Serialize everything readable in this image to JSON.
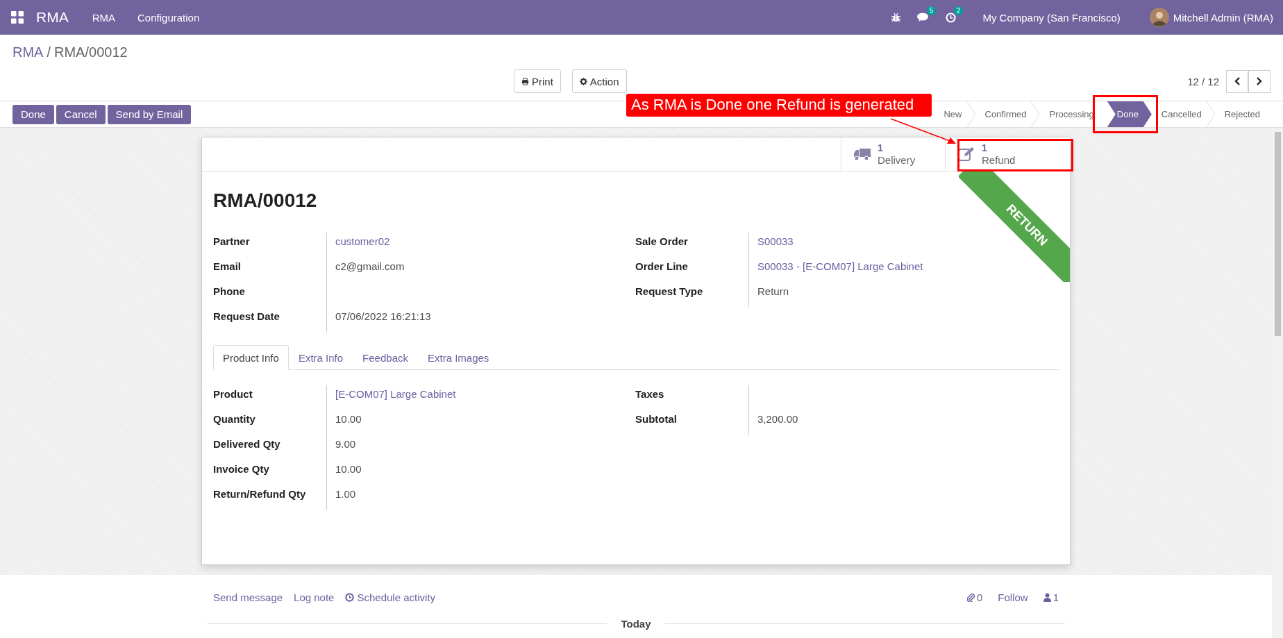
{
  "navbar": {
    "app_name": "RMA",
    "menus": [
      "RMA",
      "Configuration"
    ],
    "messages_count": "5",
    "activities_count": "2",
    "company": "My Company (San Francisco)",
    "user": "Mitchell Admin (RMA)"
  },
  "breadcrumb": {
    "parent": "RMA",
    "separator": "/",
    "current": "RMA/00012"
  },
  "actions": [
    {
      "label": "Print",
      "kind": "print"
    },
    {
      "label": "Action",
      "kind": "gear"
    }
  ],
  "pager": "12 / 12",
  "header_buttons": [
    "Done",
    "Cancel",
    "Send by Email"
  ],
  "statusbar": [
    {
      "label": "New",
      "selected": false
    },
    {
      "label": "Confirmed",
      "selected": false
    },
    {
      "label": "Processing",
      "selected": false
    },
    {
      "label": "Done",
      "selected": true
    },
    {
      "label": "Cancelled",
      "selected": false
    },
    {
      "label": "Rejected",
      "selected": false
    }
  ],
  "annotation": "As RMA is Done one Refund is generated",
  "smart_buttons": [
    {
      "count": "1",
      "label": "Delivery",
      "kind": "truck"
    },
    {
      "count": "1",
      "label": "Refund",
      "kind": "edit"
    }
  ],
  "ribbon": "RETURN",
  "title": "RMA/00012",
  "left_fields": [
    {
      "label": "Partner",
      "value": "customer02",
      "kind": "link"
    },
    {
      "label": "Email",
      "value": "c2@gmail.com",
      "kind": "text"
    },
    {
      "label": "Phone"
    },
    {
      "label": "Request Date",
      "value": "07/06/2022 16:21:13",
      "kind": "text"
    }
  ],
  "right_fields": [
    {
      "label": "Sale Order",
      "value": "S00033",
      "kind": "link"
    },
    {
      "label": "Order Line",
      "value": "S00033 - [E-COM07] Large Cabinet",
      "kind": "link"
    },
    {
      "label": "Request Type",
      "value": "Return",
      "kind": "text"
    }
  ],
  "tabs": [
    {
      "label": "Product Info",
      "selected": true
    },
    {
      "label": "Extra Info",
      "selected": false
    },
    {
      "label": "Feedback",
      "selected": false
    },
    {
      "label": "Extra Images",
      "selected": false
    }
  ],
  "product_left_fields": [
    {
      "label": "Product",
      "value": "[E-COM07] Large Cabinet",
      "kind": "link"
    },
    {
      "label": "Quantity",
      "value": "10.00",
      "kind": "text"
    },
    {
      "label": "Delivered Qty",
      "value": "9.00",
      "kind": "text"
    },
    {
      "label": "Invoice Qty",
      "value": "10.00",
      "kind": "text"
    },
    {
      "label": "Return/Refund Qty",
      "value": "1.00",
      "kind": "text"
    }
  ],
  "product_right_fields": [
    {
      "label": "Taxes"
    },
    {
      "label": "Subtotal",
      "value": "3,200.00",
      "kind": "text"
    }
  ],
  "chatter": {
    "actions": [
      {
        "label": "Send message",
        "kind": "plain"
      },
      {
        "label": "Log note",
        "kind": "plain"
      },
      {
        "label": "Schedule activity",
        "kind": "clock"
      }
    ],
    "attachments": "0",
    "follow": "Follow",
    "followers": "1",
    "separator": "Today"
  }
}
